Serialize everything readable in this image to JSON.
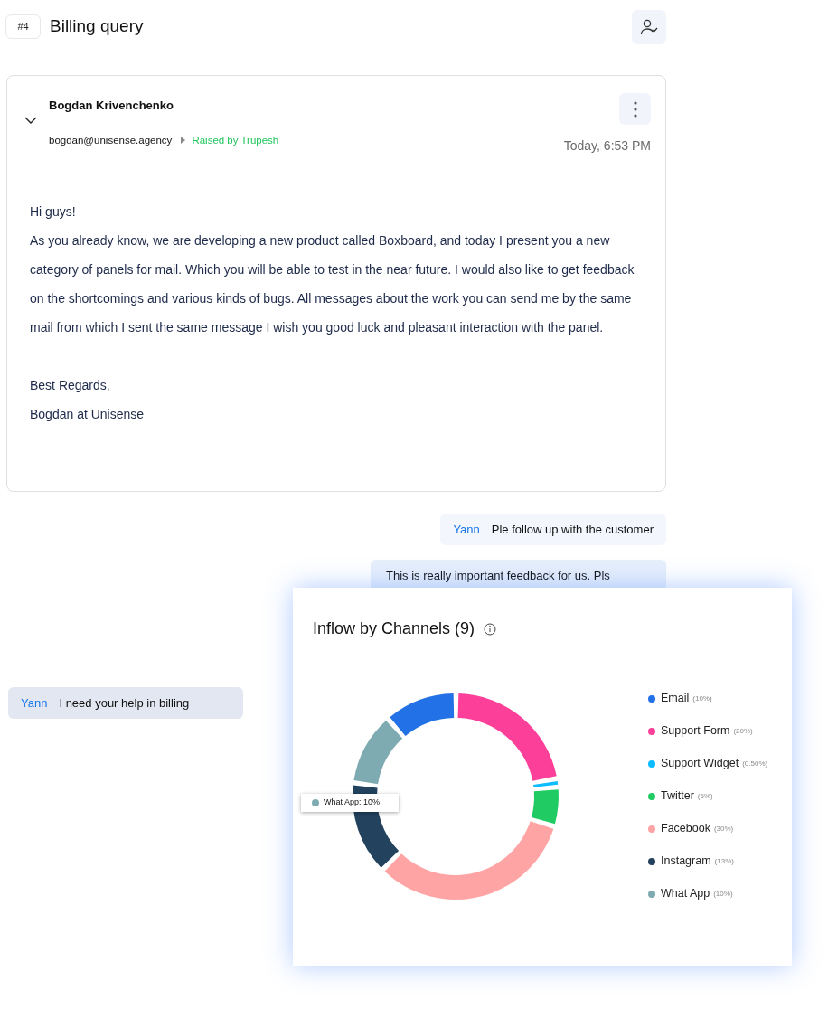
{
  "ticket": {
    "number": "#4",
    "title": "Billing query"
  },
  "email": {
    "sender": "Bogdan Krivenchenko",
    "address": "bogdan@unisense.agency",
    "raised_by": "Raised by Trupesh",
    "time": "Today, 6:53 PM",
    "expanded": true,
    "body": [
      "Hi guys!",
      "As you already know, we are developing a new product called Boxboard, and today I present you a new category of panels for mail. Which you will be able to test in the near future. I would also like to get feedback on the shortcomings and various kinds of bugs. All messages about the work you can send me by the same mail from which I sent the same message I wish you good luck and pleasant interaction with the panel."
    ],
    "signature": [
      "Best Regards,",
      "Bogdan at Unisense"
    ]
  },
  "notes": [
    {
      "author": "Yann",
      "text": "Ple follow up with the customer",
      "kind": "outgoing"
    },
    {
      "text": "This is really important feedback for us. Pls",
      "kind": "outgoing"
    },
    {
      "author": "Yann",
      "text": "I need your help in billing",
      "kind": "incoming"
    }
  ],
  "chart_card": {
    "title": "Inflow by Channels (9)",
    "legend": [
      {
        "share": "(10%)",
        "color": "#2271e6"
      },
      {
        "share": "(20%)",
        "color": "#fc3f98"
      },
      {
        "share": "(0.50%)",
        "color": "#0bbcff"
      },
      {
        "share": "(5%)",
        "color": "#1fcb62"
      },
      {
        "share": "(30%)",
        "color": "#ffa4a4"
      },
      {
        "share": "(13%)",
        "color": "#22425e"
      },
      {
        "share": "(10%)",
        "color": "#7eabb1"
      }
    ],
    "tooltip": {
      "label": "What App: 10%",
      "color": "#7eabb1"
    },
    "chart_data": {
      "type": "donut",
      "categories": [
        "Email",
        "Support Form",
        "Support Widget",
        "Twitter",
        "Facebook",
        "Instagram",
        "What App"
      ],
      "series": [
        {
          "values": [
            11.3,
            22.6,
            0.56,
            5.65,
            33.9,
            14.69,
            11.3
          ]
        }
      ]
    }
  }
}
